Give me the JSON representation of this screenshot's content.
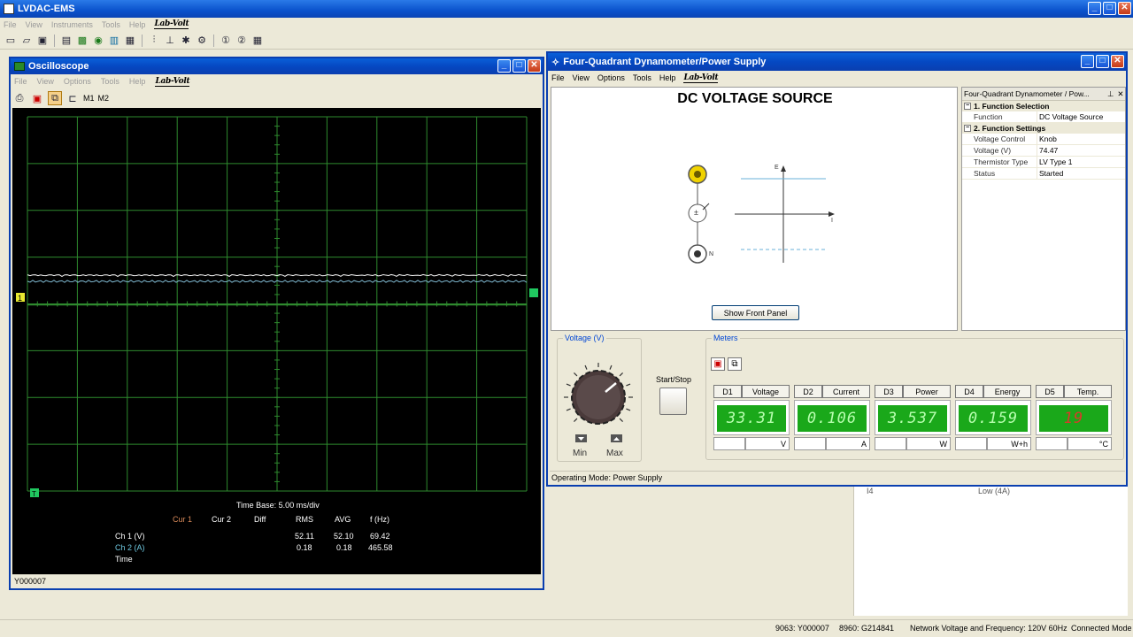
{
  "app": {
    "title": "LVDAC-EMS",
    "menu": [
      "File",
      "View",
      "Instruments",
      "Tools",
      "Help"
    ],
    "brand": "Lab-Volt",
    "status": {
      "s1": "9063: Y000007",
      "s2": "8960: G214841",
      "s3": "Network Voltage and Frequency: 120V 60Hz",
      "s4": "Connected Mode"
    }
  },
  "oscilloscope": {
    "title": "Oscilloscope",
    "menu": [
      "File",
      "View",
      "Options",
      "Tools",
      "Help"
    ],
    "toolbar_m1": "M1",
    "toolbar_m2": "M2",
    "ch1_marker": "1",
    "trig_marker": "T",
    "time_base": "Time Base: 5.00 ms/div",
    "headers": {
      "cur1": "Cur 1",
      "cur2": "Cur 2",
      "diff": "Diff",
      "rms": "RMS",
      "avg": "AVG",
      "f": "f (Hz)"
    },
    "rows": [
      {
        "label": "Ch 1 (V)",
        "rms": "52.11",
        "avg": "52.10",
        "f": "69.42"
      },
      {
        "label": "Ch 2 (A)",
        "rms": "0.18",
        "avg": "0.18",
        "f": "465.58"
      },
      {
        "label": "Time"
      }
    ],
    "status": "Y000007"
  },
  "dynamometer": {
    "title": "Four-Quadrant Dynamometer/Power Supply",
    "menu": [
      "File",
      "View",
      "Options",
      "Tools",
      "Help"
    ],
    "heading": "DC VOLTAGE SOURCE",
    "axis_e": "E",
    "axis_i": "I",
    "terminal_n": "N",
    "show_front_panel": "Show Front Panel",
    "properties": {
      "title": "Four-Quadrant Dynamometer / Pow...",
      "cat1": "1. Function Selection",
      "cat2": "2. Function Settings",
      "function_k": "Function",
      "function_v": "DC Voltage Source",
      "vc_k": "Voltage Control",
      "vc_v": "Knob",
      "volt_k": "Voltage (V)",
      "volt_v": "74.47",
      "therm_k": "Thermistor Type",
      "therm_v": "LV Type 1",
      "status_k": "Status",
      "status_v": "Started"
    },
    "voltage_group": "Voltage (V)",
    "knob_min": "Min",
    "knob_max": "Max",
    "start_stop": "Start/Stop",
    "meters_group": "Meters",
    "meters": [
      {
        "id": "D1",
        "name": "Voltage",
        "value": "33.31",
        "unit": "V"
      },
      {
        "id": "D2",
        "name": "Current",
        "value": "0.106",
        "unit": "A"
      },
      {
        "id": "D3",
        "name": "Power",
        "value": "3.537",
        "unit": "W"
      },
      {
        "id": "D4",
        "name": "Energy",
        "value": "0.159",
        "unit": "W+h"
      },
      {
        "id": "D5",
        "name": "Temp.",
        "value": "19",
        "unit": "°C"
      }
    ],
    "status": "Operating Mode: Power Supply"
  },
  "background_list": {
    "rows": [
      {
        "k": "I4",
        "v": "Low (4A)"
      }
    ]
  },
  "colors": {
    "scope_grid": "#2e8a2e",
    "scope_trace1": "#ffffff",
    "lcd_green": "#1aa81a",
    "temp_text": "#d83a2a"
  }
}
